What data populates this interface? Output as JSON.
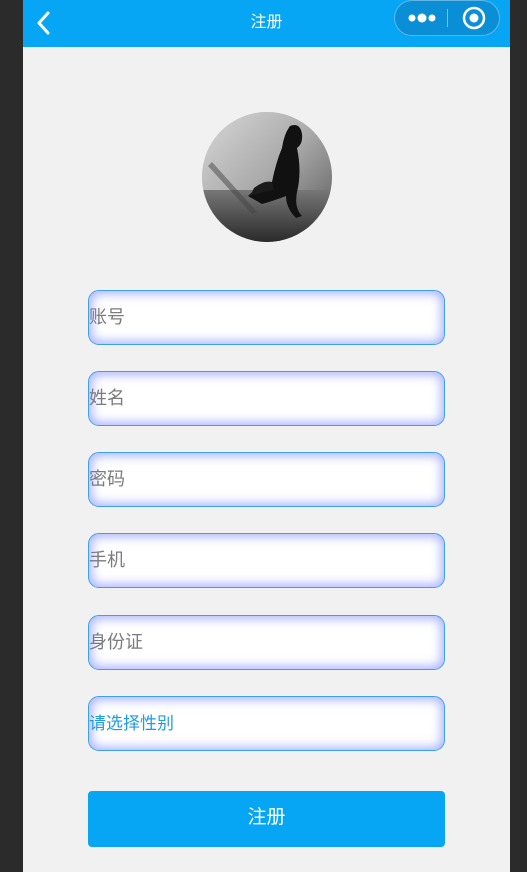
{
  "navbar": {
    "title": "注册",
    "back_icon": "chevron-left-icon",
    "menu_icon": "more-dots-icon",
    "close_icon": "target-icon"
  },
  "avatar": {
    "description": "profile-photo"
  },
  "form": {
    "account_placeholder": "账号",
    "name_placeholder": "姓名",
    "password_placeholder": "密码",
    "phone_placeholder": "手机",
    "id_card_placeholder": "身份证",
    "gender_picker_label": "请选择性别"
  },
  "submit_label": "注册",
  "colors": {
    "primary": "#07a6f5",
    "background": "#f1f1f1",
    "field_border": "#3c9ff0",
    "picker_text": "#1f9be6"
  }
}
